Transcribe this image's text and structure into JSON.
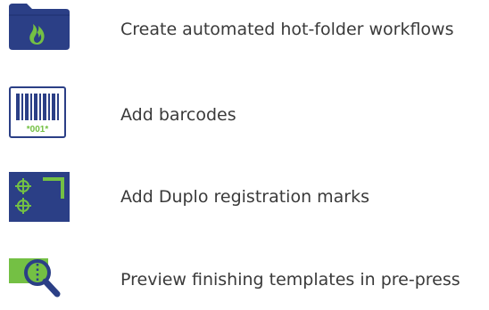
{
  "colors": {
    "navy": "#2b3f86",
    "green": "#74c044",
    "text": "#3a3a3a"
  },
  "features": [
    {
      "icon": "hot-folder-flame-icon",
      "label": "Create automated hot-folder workflows"
    },
    {
      "icon": "barcode-icon",
      "label": "Add barcodes",
      "barcode_text": "*001*"
    },
    {
      "icon": "registration-marks-icon",
      "label": "Add Duplo registration marks"
    },
    {
      "icon": "magnifier-preview-icon",
      "label": "Preview finishing templates in pre-press"
    }
  ]
}
